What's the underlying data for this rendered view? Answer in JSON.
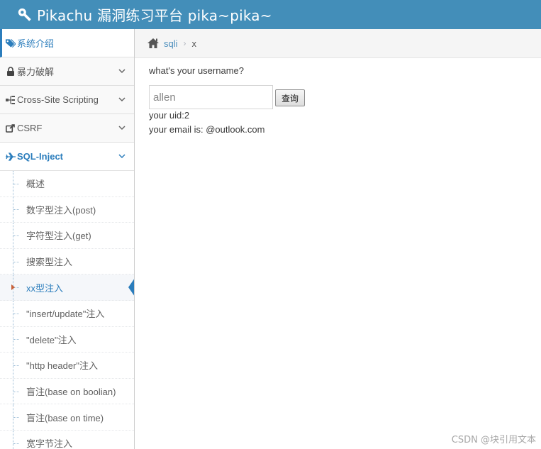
{
  "app": {
    "title": "Pikachu 漏洞练习平台 pika~pika~"
  },
  "sidebar": {
    "items": [
      {
        "label": "系统介绍",
        "icon": "tag-icon"
      },
      {
        "label": "暴力破解",
        "icon": "lock-icon"
      },
      {
        "label": "Cross-Site Scripting",
        "icon": "sitemap-icon"
      },
      {
        "label": "CSRF",
        "icon": "share-icon"
      },
      {
        "label": "SQL-Inject",
        "icon": "plane-icon"
      }
    ],
    "sub_items": [
      "概述",
      "数字型注入(post)",
      "字符型注入(get)",
      "搜索型注入",
      "xx型注入",
      "\"insert/update\"注入",
      "\"delete\"注入",
      "\"http header\"注入",
      "盲注(base on boolian)",
      "盲注(base on time)",
      "宽字节注入"
    ],
    "active_sub_item": "xx型注入"
  },
  "breadcrumb": {
    "link": "sqli",
    "current": "x"
  },
  "form": {
    "question": "what's your username?",
    "username_value": "allen",
    "submit_label": "查询"
  },
  "result": {
    "uid_line": "your uid:2",
    "email_line": "your email is: @outlook.com"
  },
  "watermark": "CSDN @块引用文本",
  "colors": {
    "navbar": "#438eb9",
    "accent": "#2b7dbc",
    "active_caret": "#c86139"
  }
}
